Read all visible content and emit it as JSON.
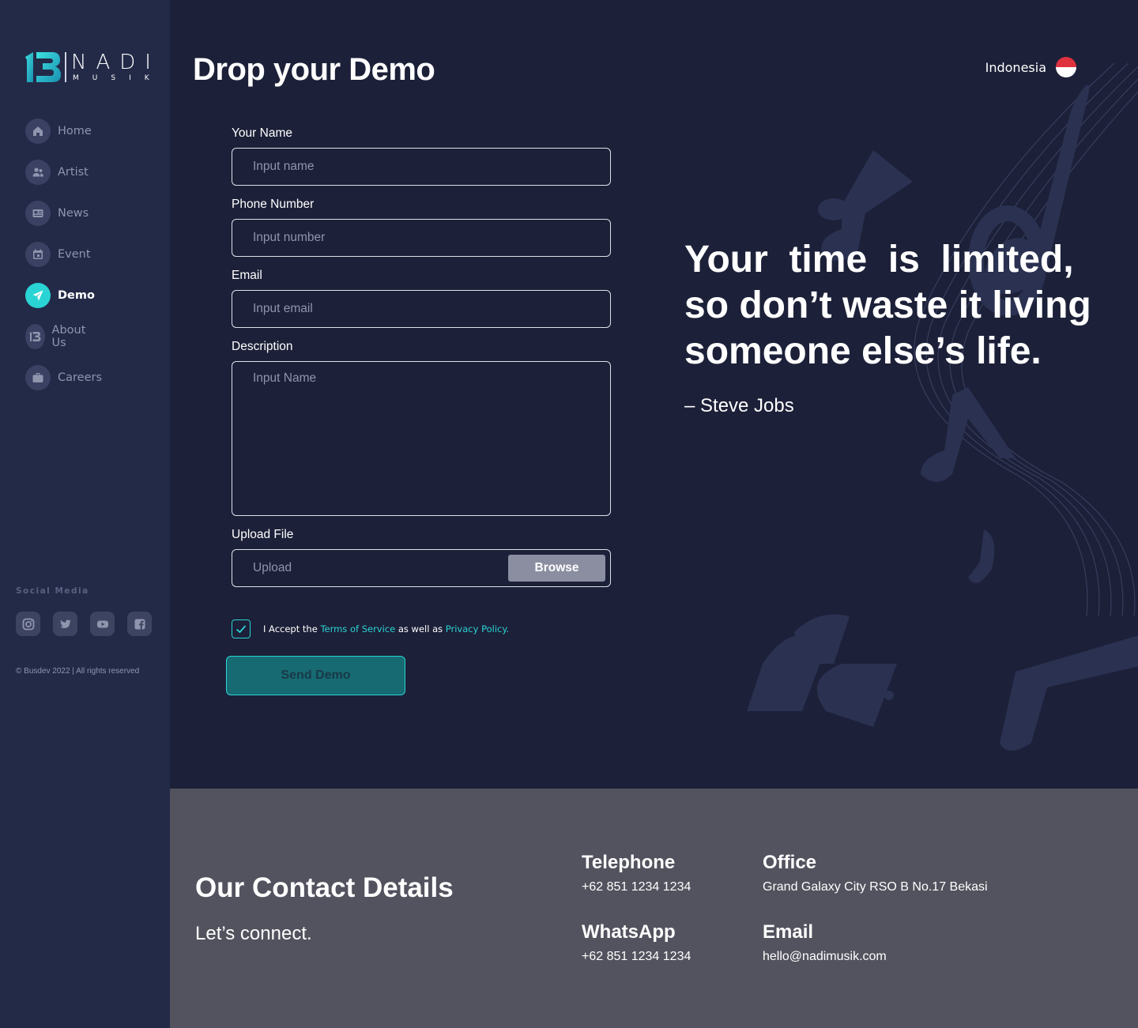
{
  "brand": {
    "mark": "13",
    "word": "NADI",
    "sub": "MUSIK"
  },
  "sidebar": {
    "items": [
      {
        "label": "Home",
        "icon": "home-icon"
      },
      {
        "label": "Artist",
        "icon": "users-icon"
      },
      {
        "label": "News",
        "icon": "newspaper-icon"
      },
      {
        "label": "Event",
        "icon": "calendar-icon"
      },
      {
        "label": "Demo",
        "icon": "send-icon",
        "active": true
      },
      {
        "label": "About Us",
        "icon": "logo-icon"
      },
      {
        "label": "Careers",
        "icon": "briefcase-icon"
      }
    ],
    "social_title": "Social Media",
    "social": [
      "instagram-icon",
      "twitter-icon",
      "youtube-icon",
      "facebook-icon"
    ],
    "copyright": "© Busdev 2022 | All rights reserved"
  },
  "header": {
    "title": "Drop your Demo",
    "language": "Indonesia"
  },
  "form": {
    "name_label": "Your Name",
    "name_placeholder": "Input name",
    "phone_label": "Phone Number",
    "phone_placeholder": "Input number",
    "email_label": "Email",
    "email_placeholder": "Input email",
    "description_label": "Description",
    "description_placeholder": "Input Name",
    "upload_label": "Upload File",
    "upload_placeholder": "Upload",
    "browse_label": "Browse",
    "accept_prefix": "I Accept the ",
    "terms_link": "Terms of Service",
    "accept_middle": " as well as ",
    "privacy_link": "Privacy Policy.",
    "accepted": true,
    "send_label": "Send Demo"
  },
  "quote": {
    "text": "Your  time  is  limited, so don’t waste it living someone else’s life.",
    "author": "– Steve Jobs"
  },
  "footer": {
    "title": "Our Contact Details",
    "subtitle": "Let’s connect.",
    "telephone_label": "Telephone",
    "telephone": "+62 851 1234 1234",
    "office_label": "Office",
    "office": "Grand Galaxy City RSO B No.17 Bekasi",
    "whatsapp_label": "WhatsApp",
    "whatsapp": "+62 851 1234 1234",
    "email_label": "Email",
    "email": "hello@nadimusik.com"
  },
  "colors": {
    "accent": "#2bd4d4",
    "sidebar": "#232a48",
    "main": "#1c2038",
    "footer": "#53535f"
  }
}
